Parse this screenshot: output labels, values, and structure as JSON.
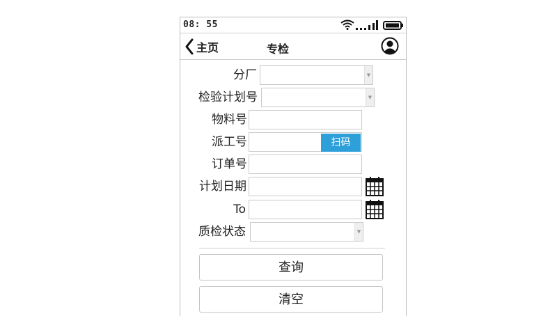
{
  "status_bar": {
    "time": "08: 55",
    "icons": [
      "wifi-icon",
      "signal-icon",
      "battery-icon"
    ]
  },
  "nav": {
    "back_label": "主页",
    "title": "专检",
    "user_icon": "user-icon"
  },
  "form": {
    "branch_label": "分厂",
    "branch_value": "",
    "inspection_plan_label": "检验计划号",
    "inspection_plan_value": "",
    "material_label": "物料号",
    "material_value": "",
    "dispatch_label": "派工号",
    "dispatch_value": "",
    "scan_label": "扫码",
    "order_label": "订单号",
    "order_value": "",
    "plan_date_label": "计划日期",
    "plan_date_value": "",
    "to_label": "To",
    "to_value": "",
    "qc_status_label": "质检状态",
    "qc_status_value": ""
  },
  "actions": {
    "query_label": "查询",
    "clear_label": "清空"
  },
  "colors": {
    "accent": "#2d9fd9",
    "border": "#c9c9c9"
  }
}
